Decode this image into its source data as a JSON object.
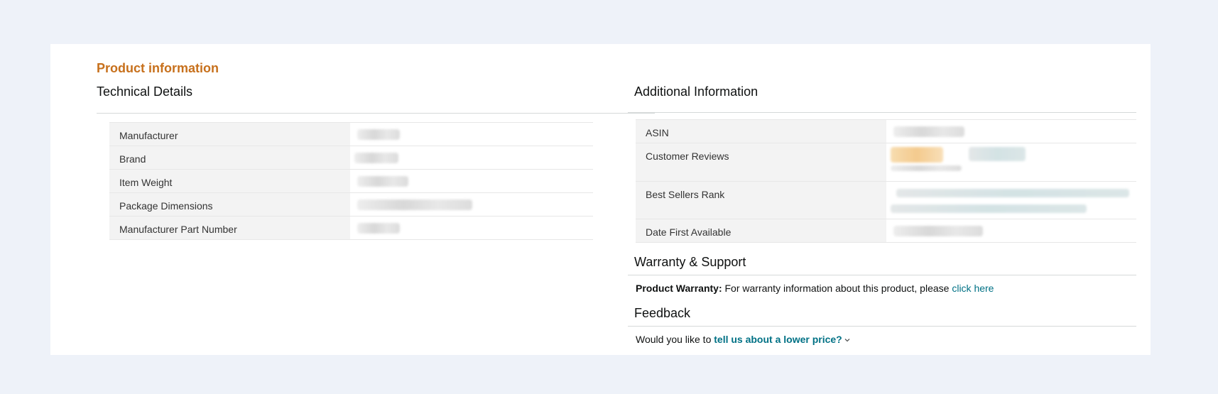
{
  "page": {
    "title": "Product information"
  },
  "technical_details": {
    "title": "Technical Details",
    "rows": [
      {
        "label": "Manufacturer",
        "value": "",
        "redacted": true
      },
      {
        "label": "Brand",
        "value": "",
        "redacted": true
      },
      {
        "label": "Item Weight",
        "value": "",
        "redacted": true
      },
      {
        "label": "Package Dimensions",
        "value": "",
        "redacted": true
      },
      {
        "label": "Manufacturer Part Number",
        "value": "",
        "redacted": true
      }
    ]
  },
  "additional_information": {
    "title": "Additional Information",
    "rows": [
      {
        "label": "ASIN",
        "value": "",
        "redacted": true
      },
      {
        "label": "Customer Reviews",
        "value": "",
        "redacted": true
      },
      {
        "label": "Best Sellers Rank",
        "value": "",
        "redacted": true
      },
      {
        "label": "Date First Available",
        "value": "",
        "redacted": true
      }
    ]
  },
  "warranty": {
    "title": "Warranty & Support",
    "label": "Product Warranty:",
    "text": "For warranty information about this product, please",
    "link": "click here"
  },
  "feedback": {
    "title": "Feedback",
    "text": "Would you like to",
    "link": "tell us about a lower price?"
  },
  "colors": {
    "title_accent": "#c7701c",
    "link": "#007185",
    "page_background": "#eef2f9",
    "label_cell": "#f3f3f3",
    "review_stars": "#f3c582"
  },
  "icons": {
    "feedback_dropdown": "chevron-down-icon"
  }
}
